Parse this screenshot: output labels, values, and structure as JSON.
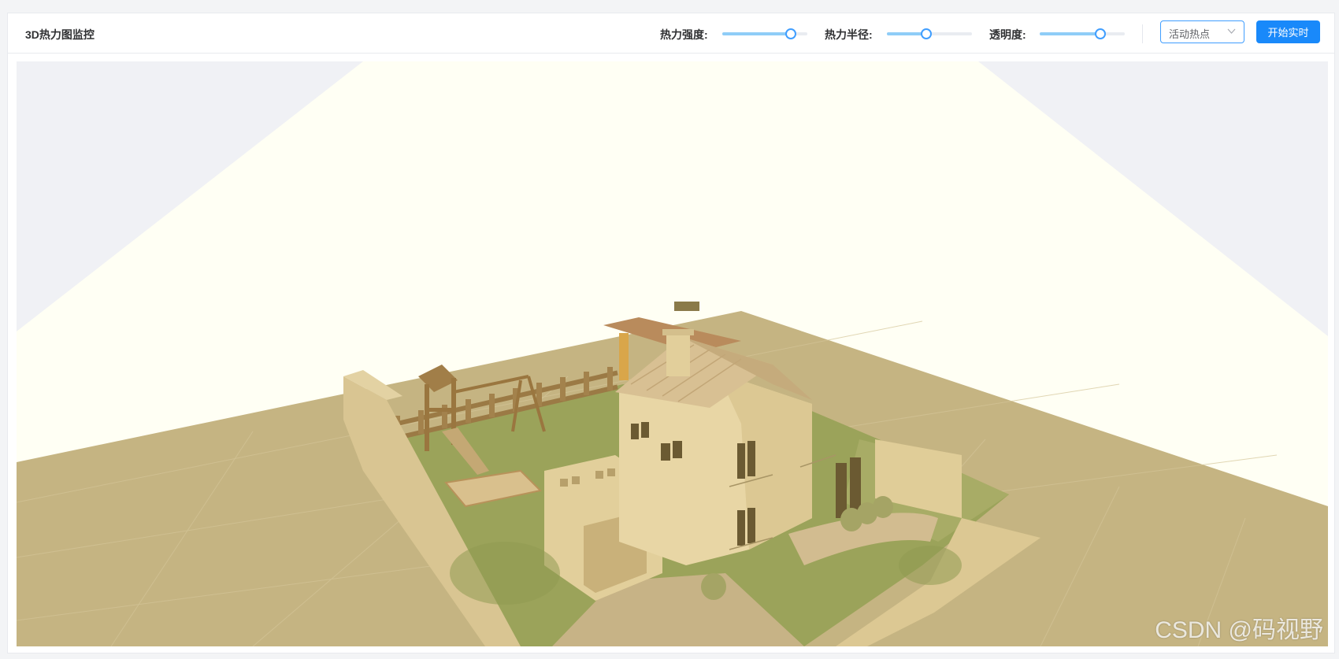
{
  "header": {
    "title": "3D热力图监控"
  },
  "controls": {
    "intensity": {
      "label": "热力强度:",
      "value": 0.8
    },
    "radius": {
      "label": "热力半径:",
      "value": 0.45
    },
    "opacity": {
      "label": "透明度:",
      "value": 0.7
    }
  },
  "mode_select": {
    "value": "活动热点"
  },
  "actions": {
    "start_label": "开始实时"
  },
  "scene": {
    "model": "house-with-garden",
    "light_beam_color": "#fffff4",
    "ground_color": "#c4b383",
    "lawn_color": "#9aa45b"
  },
  "watermark": "CSDN @码视野",
  "colors": {
    "accent": "#409eff",
    "button": "#1989fa",
    "slider_fill": "#8fcdf7"
  }
}
